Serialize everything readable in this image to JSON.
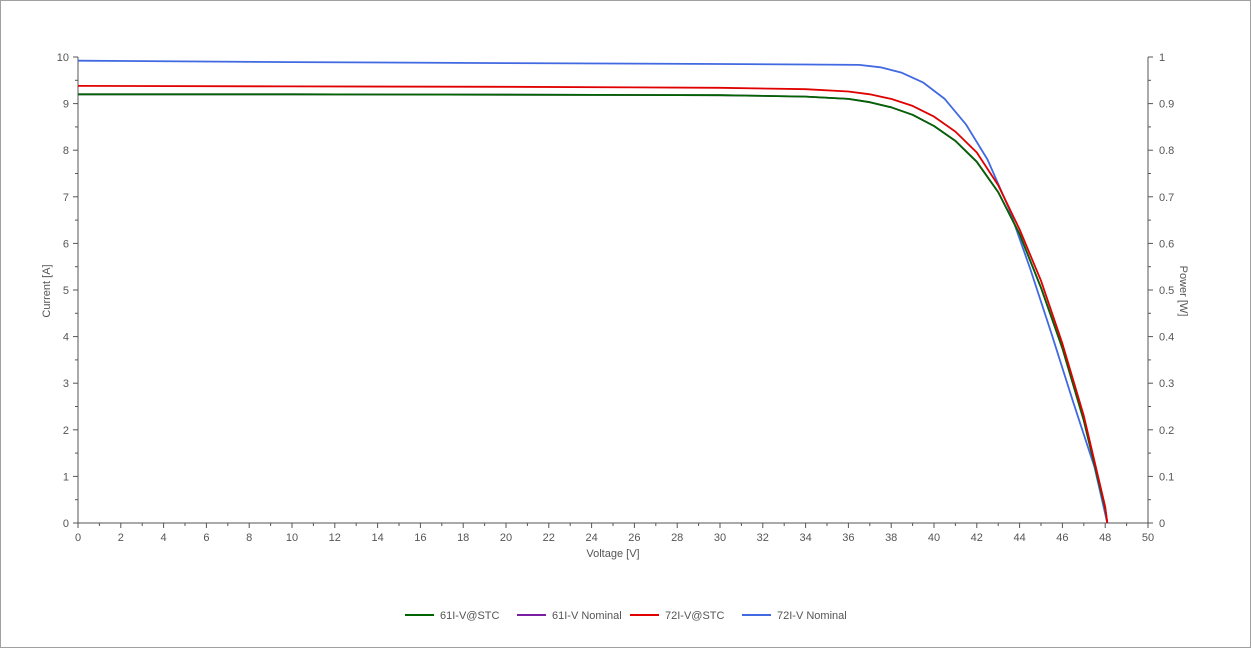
{
  "chart_data": {
    "type": "line",
    "xlabel": "Voltage [V]",
    "ylabel": "Current [A]",
    "y2label": "Power [W]",
    "xlim": [
      0,
      50
    ],
    "ylim": [
      0,
      10
    ],
    "y2lim": [
      0,
      1
    ],
    "x_ticks": [
      "0",
      "2",
      "4",
      "6",
      "8",
      "10",
      "12",
      "14",
      "16",
      "18",
      "20",
      "22",
      "24",
      "26",
      "28",
      "30",
      "32",
      "34",
      "36",
      "38",
      "40",
      "42",
      "44",
      "46",
      "48",
      "50"
    ],
    "y_ticks": [
      "0",
      "1",
      "2",
      "3",
      "4",
      "5",
      "6",
      "7",
      "8",
      "9",
      "10"
    ],
    "y2_ticks": [
      "0",
      "0.1",
      "0.2",
      "0.3",
      "0.4",
      "0.5",
      "0.6",
      "0.7",
      "0.8",
      "0.9",
      "1"
    ],
    "grid": false,
    "legend_position": "bottom",
    "series": [
      {
        "name": "61I-V@STC",
        "color": "#006400",
        "points": [
          [
            0,
            9.2
          ],
          [
            10,
            9.2
          ],
          [
            20,
            9.19
          ],
          [
            30,
            9.18
          ],
          [
            34,
            9.15
          ],
          [
            36,
            9.1
          ],
          [
            37,
            9.03
          ],
          [
            38,
            8.92
          ],
          [
            39,
            8.76
          ],
          [
            40,
            8.52
          ],
          [
            41,
            8.2
          ],
          [
            42,
            7.75
          ],
          [
            43,
            7.1
          ],
          [
            44,
            6.2
          ],
          [
            45,
            5.05
          ],
          [
            46,
            3.75
          ],
          [
            47,
            2.2
          ],
          [
            48,
            0.3
          ],
          [
            48.1,
            0
          ]
        ]
      },
      {
        "name": "61I-V Nominal",
        "color": "#7b1fa2",
        "points": [
          [
            0,
            9.2
          ],
          [
            10,
            9.2
          ],
          [
            20,
            9.19
          ],
          [
            30,
            9.18
          ],
          [
            34,
            9.15
          ],
          [
            36,
            9.1
          ],
          [
            37,
            9.03
          ],
          [
            38,
            8.92
          ],
          [
            39,
            8.76
          ],
          [
            40,
            8.52
          ],
          [
            41,
            8.2
          ],
          [
            42,
            7.75
          ],
          [
            43,
            7.1
          ],
          [
            44,
            6.2
          ],
          [
            45,
            5.05
          ],
          [
            46,
            3.75
          ],
          [
            47,
            2.2
          ],
          [
            48,
            0.3
          ],
          [
            48.1,
            0
          ]
        ]
      },
      {
        "name": "72I-V@STC",
        "color": "#e00000",
        "points": [
          [
            0,
            9.38
          ],
          [
            10,
            9.37
          ],
          [
            20,
            9.36
          ],
          [
            30,
            9.34
          ],
          [
            34,
            9.31
          ],
          [
            36,
            9.26
          ],
          [
            37,
            9.2
          ],
          [
            38,
            9.1
          ],
          [
            39,
            8.95
          ],
          [
            40,
            8.72
          ],
          [
            41,
            8.4
          ],
          [
            42,
            7.95
          ],
          [
            43,
            7.25
          ],
          [
            44,
            6.3
          ],
          [
            45,
            5.2
          ],
          [
            46,
            3.85
          ],
          [
            47,
            2.3
          ],
          [
            48,
            0.35
          ],
          [
            48.1,
            0
          ]
        ]
      },
      {
        "name": "72I-V Nominal",
        "color": "#4169e1",
        "points": [
          [
            0,
            9.92
          ],
          [
            10,
            9.89
          ],
          [
            20,
            9.87
          ],
          [
            30,
            9.85
          ],
          [
            34,
            9.84
          ],
          [
            36.5,
            9.83
          ],
          [
            37.5,
            9.78
          ],
          [
            38.5,
            9.66
          ],
          [
            39.5,
            9.45
          ],
          [
            40.5,
            9.1
          ],
          [
            41.5,
            8.55
          ],
          [
            42.5,
            7.8
          ],
          [
            43.5,
            6.75
          ],
          [
            44.5,
            5.45
          ],
          [
            45.5,
            4.05
          ],
          [
            46.5,
            2.6
          ],
          [
            47.5,
            1.2
          ],
          [
            48.1,
            0
          ]
        ]
      }
    ]
  }
}
